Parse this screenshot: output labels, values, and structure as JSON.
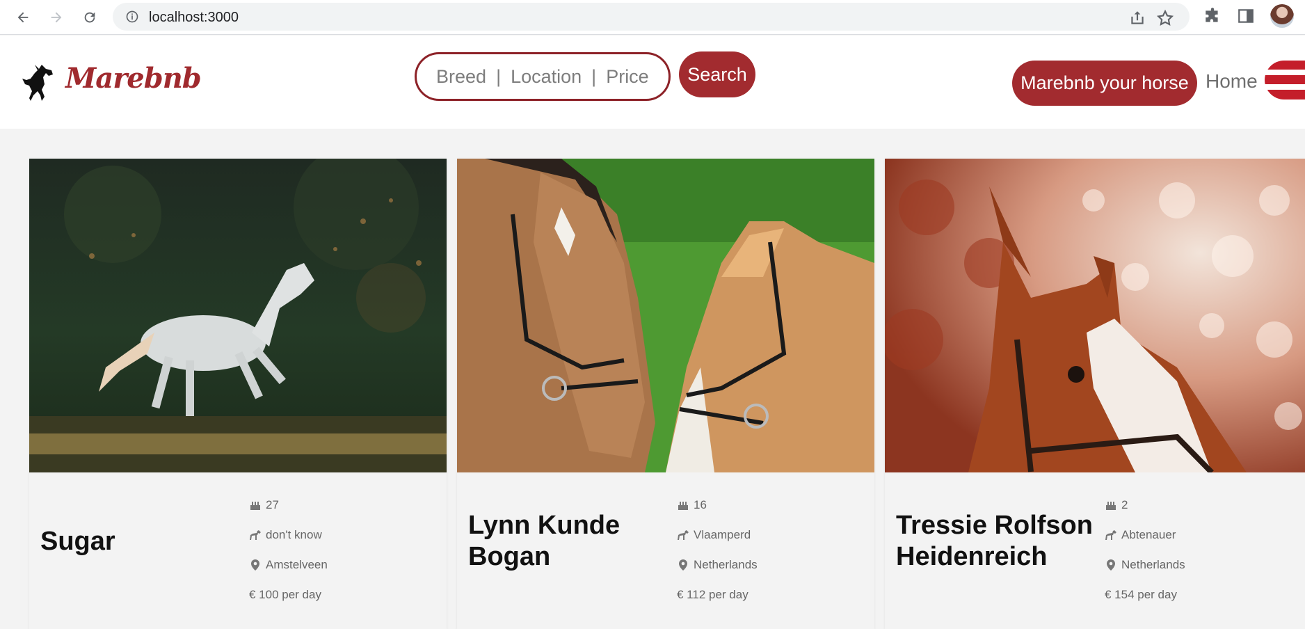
{
  "browser": {
    "url": "localhost:3000"
  },
  "header": {
    "brand": "Marebnb",
    "search": {
      "breed": "Breed",
      "location": "Location",
      "price": "Price",
      "separator": "|",
      "button": "Search"
    },
    "host_button": "Marebnb your horse",
    "home_link": "Home"
  },
  "colors": {
    "brand": "#a22b2f",
    "brand_dark": "#8d2228",
    "menu_stripe": "#c41e2a"
  },
  "cards": [
    {
      "name": "Sugar",
      "age": "27",
      "breed": "don't know",
      "location": "Amstelveen",
      "price": "€ 100 per day"
    },
    {
      "name": "Lynn Kunde Bogan",
      "age": "16",
      "breed": "Vlaamperd",
      "location": "Netherlands",
      "price": "€ 112 per day"
    },
    {
      "name": "Tressie Rolfson Heidenreich",
      "age": "2",
      "breed": "Abtenauer",
      "location": "Netherlands",
      "price": "€ 154 per day"
    }
  ],
  "icons": {
    "age": "birthday-cake-icon",
    "breed": "horse-icon",
    "location": "map-marker-icon"
  }
}
